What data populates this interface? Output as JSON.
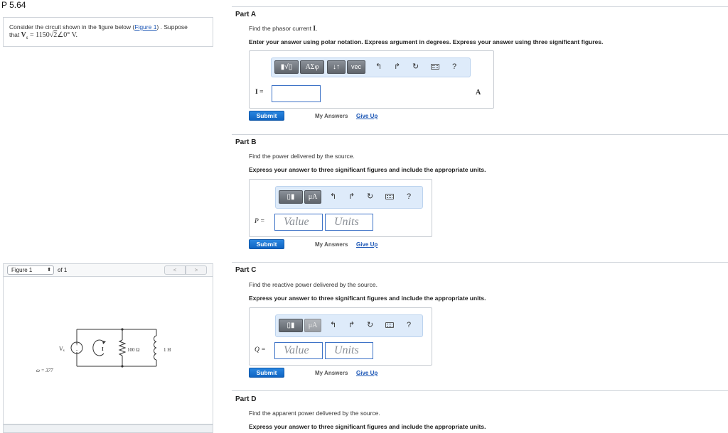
{
  "page": {
    "title": "P 5.64"
  },
  "problem": {
    "text_before_link": "Consider the circuit shown in the figure below (",
    "link_label": "Figure 1",
    "text_after_link": ") . Suppose",
    "text_line2": "that ",
    "voltage_expr": "V",
    "voltage_sub": "s",
    "voltage_eq": " = 1150",
    "sqrt_symbol": "√",
    "sqrt_arg": "2",
    "angle_expr": "∠0° V."
  },
  "figure": {
    "select_label": "Figure 1",
    "select_arrows": "⬍",
    "count_label": "of 1",
    "prev_label": "<",
    "next_label": ">",
    "source_label": "V",
    "source_sub": "s",
    "current_label": "I",
    "resistor_label": "100 Ω",
    "inductor_label": "1 H",
    "omega_label": "ω = 377"
  },
  "toolbar": {
    "templates_glyph": "▮√▯",
    "greek_label": "ΑΣφ",
    "arrows_label": "↓↑",
    "vec_label": "vec",
    "units_templates_glyph": "▯▮",
    "mu_label": "μA",
    "undo_glyph": "↰",
    "redo_glyph": "↱",
    "reset_glyph": "↻",
    "help_glyph": "?"
  },
  "actions": {
    "submit_label": "Submit",
    "my_answers_label": "My Answers",
    "give_up_label": "Give Up"
  },
  "parts": [
    {
      "title": "Part A",
      "prompt_text": "Find the phasor current ",
      "prompt_var": "I",
      "prompt_end": ".",
      "instruction": "Enter your answer using polar notation. Express argument in degrees. Express your answer using three significant figures.",
      "answer_label": "I =",
      "unit": "A"
    },
    {
      "title": "Part B",
      "prompt_text": "Find the power delivered by the source.",
      "instruction": "Express your answer to three significant figures and include the appropriate units.",
      "answer_label": "P =",
      "value_placeholder": "Value",
      "units_placeholder": "Units"
    },
    {
      "title": "Part C",
      "prompt_text": "Find the reactive power delivered by the source.",
      "instruction": "Express your answer to three significant figures and include the appropriate units.",
      "answer_label": "Q =",
      "value_placeholder": "Value",
      "units_placeholder": "Units"
    },
    {
      "title": "Part D",
      "prompt_text": "Find the apparent power delivered by the source.",
      "instruction": "Express your answer to three significant figures and include the appropriate units."
    }
  ]
}
